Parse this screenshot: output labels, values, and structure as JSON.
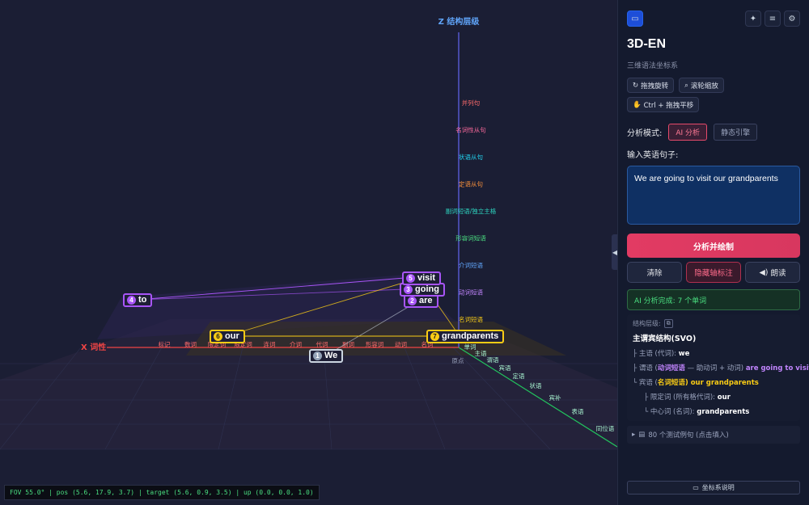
{
  "axes": {
    "z_title": "Z 结构层级",
    "x_title": "X 词性",
    "origin": "原点",
    "z_levels": [
      {
        "label": "并列句",
        "color": "#ff6b6b"
      },
      {
        "label": "名词性从句",
        "color": "#ff6b9e"
      },
      {
        "label": "状语从句",
        "color": "#22d3ee"
      },
      {
        "label": "定语从句",
        "color": "#fb923c"
      },
      {
        "label": "副词短语/独立主格",
        "color": "#2dd4bf"
      },
      {
        "label": "形容词短语",
        "color": "#4ade80"
      },
      {
        "label": "介词短语",
        "color": "#60a5fa"
      },
      {
        "label": "动词短语",
        "color": "#c084fc"
      },
      {
        "label": "名词短语",
        "color": "#facc15"
      }
    ],
    "pos_labels": [
      "标记",
      "数词",
      "限定词",
      "限定词",
      "连词",
      "介词",
      "代词",
      "副词",
      "形容词",
      "动词",
      "名词"
    ],
    "y_labels": [
      "单词",
      "主语",
      "谓语",
      "宾语",
      "定语",
      "状语",
      "宾补",
      "表语",
      "同位语"
    ]
  },
  "words": [
    {
      "index": "1",
      "text": "We",
      "style": "white"
    },
    {
      "index": "2",
      "text": "are",
      "style": "purple"
    },
    {
      "index": "3",
      "text": "going",
      "style": "purple"
    },
    {
      "index": "4",
      "text": "to",
      "style": "purple"
    },
    {
      "index": "5",
      "text": "visit",
      "style": "purple"
    },
    {
      "index": "6",
      "text": "our",
      "style": "yellow"
    },
    {
      "index": "7",
      "text": "grandparents",
      "style": "yellow"
    }
  ],
  "camera_status": "FOV 55.0°  | pos (5.6, 17.9, 3.7) | target (5.6, 0.9, 3.5) | up (0.0, 0.0, 1.0)",
  "panel": {
    "title": "3D-EN",
    "subtitle": "三维语法坐标系",
    "hints": {
      "rotate": "拖拽旋转",
      "zoom": "滚轮缩放",
      "pan": "Ctrl + 拖拽平移"
    },
    "mode_label": "分析模式:",
    "mode_ai": "AI 分析",
    "mode_static": "静态引擎",
    "input_label": "输入英语句子:",
    "input_value": "We are going to visit our grandparents",
    "analyze_button": "分析并绘制",
    "clear_button": "清除",
    "hide_axis_button": "隐藏轴标注",
    "read_button": "朗读",
    "status": "AI 分析完成: 7 个单词",
    "structure_head": "结构层级:",
    "structure_title": "主谓宾结构(SVO)",
    "tree": {
      "subject_prefix": "├ 主语 (代词):",
      "subject_value": "we",
      "predicate_prefix": "├ 谓语 (",
      "predicate_kind": "动词短语",
      "predicate_mid": "— 助动词 + 动词)",
      "predicate_value": "are going to visit",
      "object_prefix": "└ 宾语 (",
      "object_kind": "名词短语",
      "object_value": ") our grandparents",
      "det_prefix": "├ 限定词 (所有格代词):",
      "det_value": "our",
      "head_prefix": "└ 中心词 (名词):",
      "head_value": "grandparents"
    },
    "examples": "80 个测试例句 (点击填入)",
    "legend_button": "坐标系说明"
  },
  "colors": {
    "accent": "#e23b63",
    "purple": "#a855f7",
    "yellow": "#facc15",
    "green": "#22c55e",
    "axis_red": "#ef4444",
    "axis_blue": "#6366f1"
  }
}
